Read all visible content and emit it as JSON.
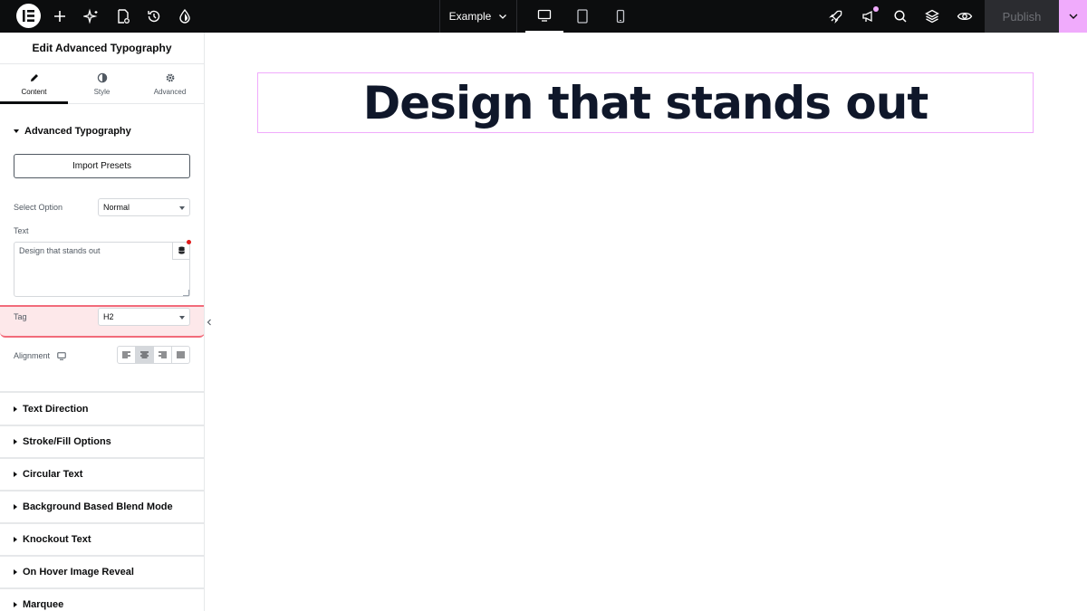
{
  "topbar": {
    "document_name": "Example",
    "publish_label": "Publish",
    "icons": [
      "elementor-logo-icon",
      "plus-icon",
      "sparkle-icon",
      "page-settings-icon",
      "history-icon",
      "theme-icon",
      "rocket-icon",
      "announcement-icon",
      "search-icon",
      "layers-icon",
      "preview-eye-icon"
    ],
    "devices": [
      "desktop",
      "tablet",
      "mobile"
    ],
    "active_device": "desktop",
    "accent_color": "#f0abfc"
  },
  "panel": {
    "title": "Edit Advanced Typography",
    "tabs": [
      {
        "label": "Content",
        "icon": "pencil-icon",
        "active": true
      },
      {
        "label": "Style",
        "icon": "half-circle-icon",
        "active": false
      },
      {
        "label": "Advanced",
        "icon": "gear-icon",
        "active": false
      }
    ],
    "section_open": "Advanced Typography",
    "import_button": "Import Presets",
    "select_option": {
      "label": "Select Option",
      "value": "Normal"
    },
    "text": {
      "label": "Text",
      "value": "Design that stands out"
    },
    "tag": {
      "label": "Tag",
      "value": "H2"
    },
    "alignment": {
      "label": "Alignment",
      "options": [
        "left",
        "center",
        "right",
        "justify"
      ],
      "active": "center"
    },
    "collapsed_sections": [
      "Text Direction",
      "Stroke/Fill Options",
      "Circular Text",
      "Background Based Blend Mode",
      "Knockout Text",
      "On Hover Image Reveal",
      "Marquee"
    ]
  },
  "canvas": {
    "heading": "Design that stands out"
  }
}
